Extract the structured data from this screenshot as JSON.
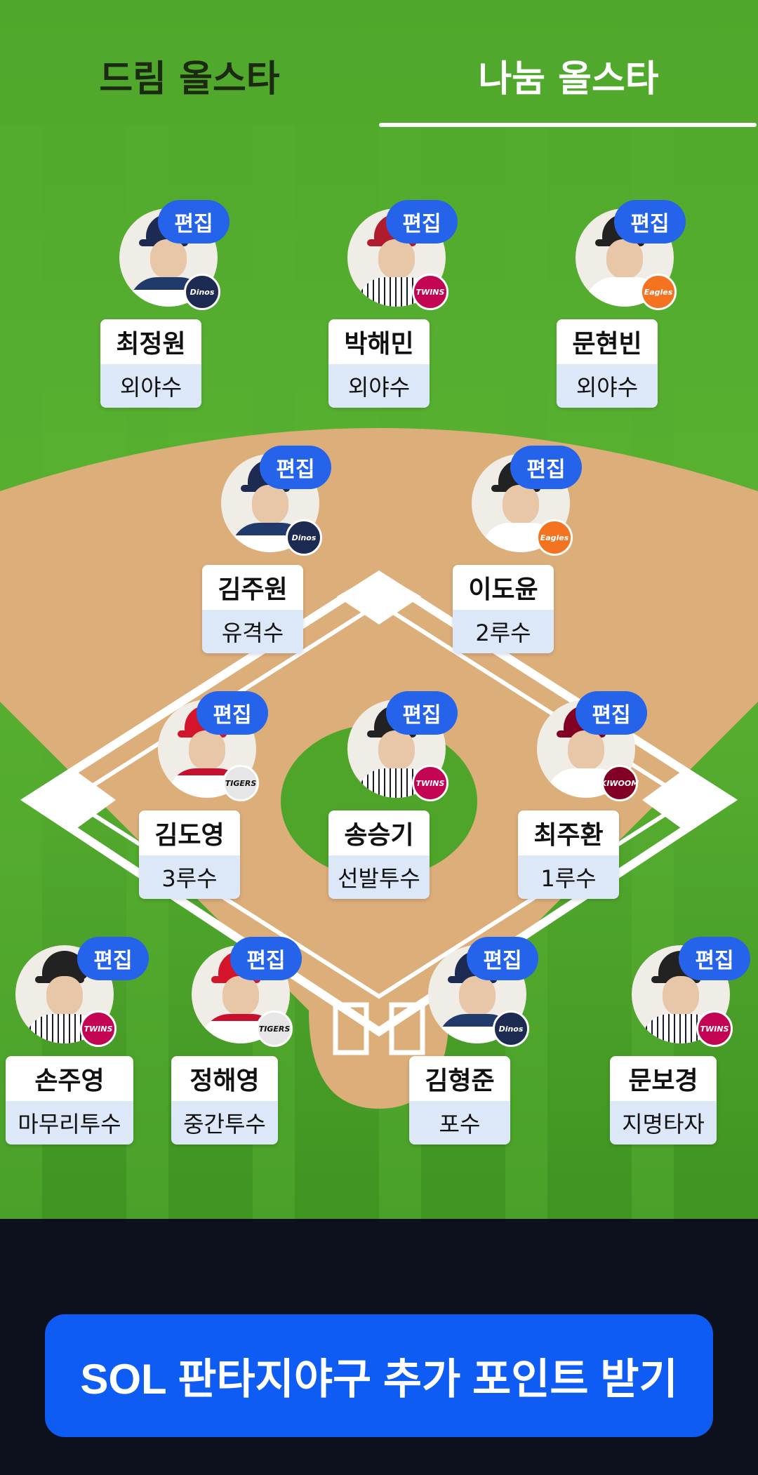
{
  "tabs": [
    {
      "label": "드림 올스타",
      "active": false
    },
    {
      "label": "나눔 올스타",
      "active": true
    }
  ],
  "edit_label": "편집",
  "players": [
    {
      "name": "최정원",
      "position": "외야수",
      "team": "Dinos",
      "team_color": "#1d2b52"
    },
    {
      "name": "박해민",
      "position": "외야수",
      "team": "TWINS",
      "team_color": "#c30452"
    },
    {
      "name": "문현빈",
      "position": "외야수",
      "team": "Eagles",
      "team_color": "#f37321"
    },
    {
      "name": "김주원",
      "position": "유격수",
      "team": "Dinos",
      "team_color": "#1d2b52"
    },
    {
      "name": "이도윤",
      "position": "2루수",
      "team": "Eagles",
      "team_color": "#f37321"
    },
    {
      "name": "김도영",
      "position": "3루수",
      "team": "TIGERS",
      "team_color": "#e6e6e6"
    },
    {
      "name": "송승기",
      "position": "선발투수",
      "team": "TWINS",
      "team_color": "#c30452"
    },
    {
      "name": "최주환",
      "position": "1루수",
      "team": "KIWOOM",
      "team_color": "#820024"
    },
    {
      "name": "손주영",
      "position": "마무리투수",
      "team": "TWINS",
      "team_color": "#c30452"
    },
    {
      "name": "정해영",
      "position": "중간투수",
      "team": "TIGERS",
      "team_color": "#e6e6e6"
    },
    {
      "name": "김형준",
      "position": "포수",
      "team": "Dinos",
      "team_color": "#1d2b52"
    },
    {
      "name": "문보경",
      "position": "지명타자",
      "team": "TWINS",
      "team_color": "#c30452"
    }
  ],
  "cta_label": "SOL 판타지야구 추가 포인트 받기",
  "colors": {
    "accent": "#2563eb",
    "cta": "#0f5cf5",
    "grass": "#4ea52a",
    "dirt": "#dcae7a",
    "bottom_bg": "#0d111d"
  }
}
